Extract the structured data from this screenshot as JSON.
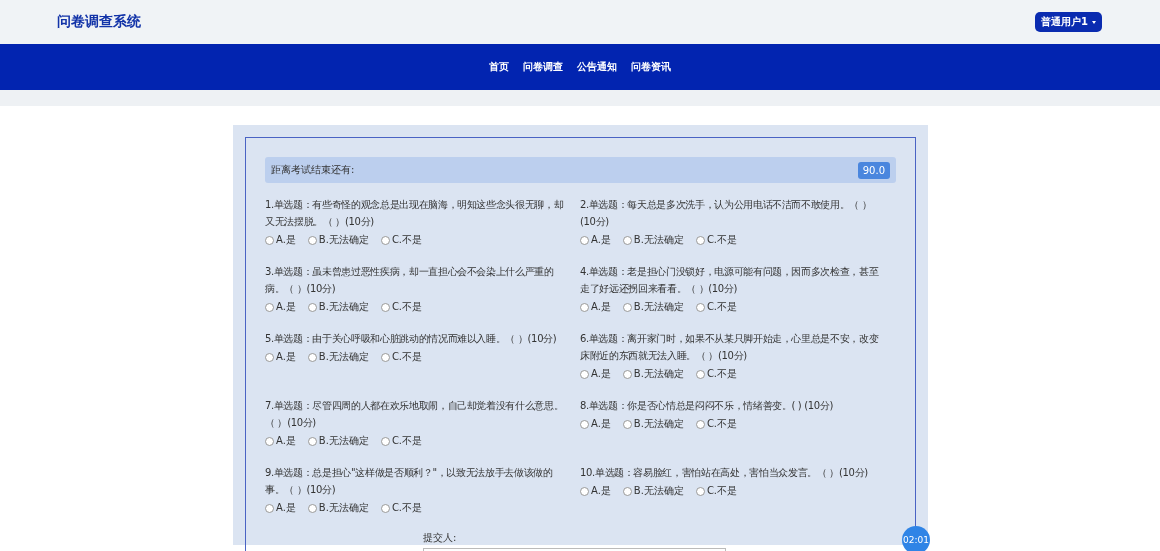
{
  "header": {
    "title": "问卷调查系统",
    "user_menu": "普通用户1"
  },
  "nav": [
    {
      "label": "首页"
    },
    {
      "label": "问卷调查"
    },
    {
      "label": "公告通知"
    },
    {
      "label": "问卷资讯"
    }
  ],
  "exam": {
    "timer_label": "距离考试结束还有:",
    "timer_value": "90.0",
    "questions": [
      {
        "text": "1.单选题：有些奇怪的观念总是出现在脑海，明知这些念头很无聊，却又无法摆脱。（ ）(10分)",
        "options": [
          {
            "label": "A.是",
            "selected": false
          },
          {
            "label": "B.无法确定",
            "selected": false
          },
          {
            "label": "C.不是",
            "selected": false
          }
        ]
      },
      {
        "text": "2.单选题：每天总是多次洗手，认为公用电话不洁而不敢使用。（ ）(10分)",
        "options": [
          {
            "label": "A.是",
            "selected": false
          },
          {
            "label": "B.无法确定",
            "selected": false
          },
          {
            "label": "C.不是",
            "selected": false
          }
        ]
      },
      {
        "text": "3.单选题：虽未曾患过恶性疾病，却一直担心会不会染上什么严重的病。（ ）(10分)",
        "options": [
          {
            "label": "A.是",
            "selected": false
          },
          {
            "label": "B.无法确定",
            "selected": false
          },
          {
            "label": "C.不是",
            "selected": false
          }
        ]
      },
      {
        "text": "4.单选题：老是担心门没锁好，电源可能有问题，因而多次检查，甚至走了好远还拐回来看看。（ ）(10分)",
        "options": [
          {
            "label": "A.是",
            "selected": false
          },
          {
            "label": "B.无法确定",
            "selected": false
          },
          {
            "label": "C.不是",
            "selected": false
          }
        ]
      },
      {
        "text": "5.单选题：由于关心呼吸和心脏跳动的情况而难以入睡。（ ）(10分)",
        "options": [
          {
            "label": "A.是",
            "selected": false
          },
          {
            "label": "B.无法确定",
            "selected": false
          },
          {
            "label": "C.不是",
            "selected": false
          }
        ]
      },
      {
        "text": "6.单选题：离开家门时，如果不从某只脚开始走，心里总是不安，改变床附近的东西就无法入睡。（ ）(10分)",
        "options": [
          {
            "label": "A.是",
            "selected": false
          },
          {
            "label": "B.无法确定",
            "selected": false
          },
          {
            "label": "C.不是",
            "selected": false
          }
        ]
      },
      {
        "text": "7.单选题：尽管四周的人都在欢乐地取闹，自己却觉着没有什么意思。（ ）(10分)",
        "options": [
          {
            "label": "A.是",
            "selected": false
          },
          {
            "label": "B.无法确定",
            "selected": false
          },
          {
            "label": "C.不是",
            "selected": false
          }
        ]
      },
      {
        "text": "8.单选题：你是否心情总是闷闷不乐，情绪善变。( ) (10分)",
        "options": [
          {
            "label": "A.是",
            "selected": false
          },
          {
            "label": "B.无法确定",
            "selected": false
          },
          {
            "label": "C.不是",
            "selected": false
          }
        ]
      },
      {
        "text": "9.单选题：总是担心\"这样做是否顺利？\"，以致无法放手去做该做的事。（ ）(10分)",
        "options": [
          {
            "label": "A.是",
            "selected": false
          },
          {
            "label": "B.无法确定",
            "selected": false
          },
          {
            "label": "C.不是",
            "selected": false
          }
        ]
      },
      {
        "text": "10.单选题：容易脸红，害怕站在高处，害怕当众发言。（ ）(10分)",
        "options": [
          {
            "label": "A.是",
            "selected": false
          },
          {
            "label": "B.无法确定",
            "selected": false
          },
          {
            "label": "C.不是",
            "selected": false
          }
        ]
      }
    ],
    "submitter_label": "提交人:"
  },
  "countdown_badge": "02:01"
}
